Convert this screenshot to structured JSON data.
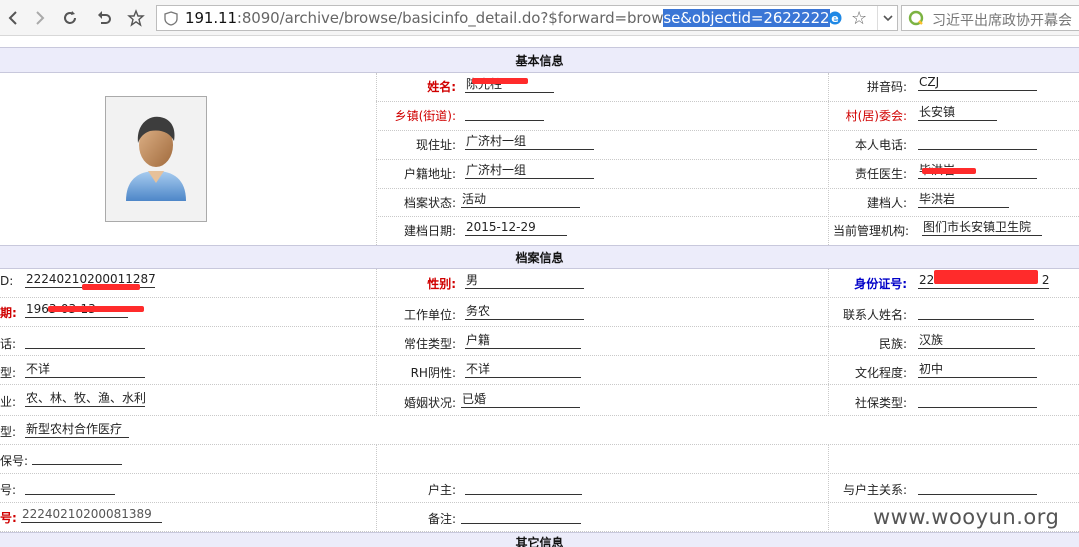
{
  "browser": {
    "url_host": "191.11",
    "url_port_path": ":8090/archive/browse/basicinfo_detail.do?$forward=brow",
    "url_selected": "se&objectid=2622222",
    "search_text": "习近平出席政协开幕会"
  },
  "sections": {
    "basic": "基本信息",
    "archive": "档案信息",
    "other": "其它信息"
  },
  "basic": {
    "name_label": "姓名:",
    "name_value": "陈光柱",
    "pinyin_label": "拼音码:",
    "pinyin_value": "CZJ",
    "township_label": "乡镇(街道):",
    "township_value": "",
    "village_label": "村(居)委会:",
    "village_value": "长安镇",
    "address_label": "现住址:",
    "address_value": "广济村一组",
    "phone_label": "本人电话:",
    "phone_value": "",
    "household_label": "户籍地址:",
    "household_value": "广济村一组",
    "doctor_label": "责任医生:",
    "doctor_value": "毕洪岩",
    "status_label": "档案状态:",
    "status_value": "活动",
    "creator_label": "建档人:",
    "creator_value": "毕洪岩",
    "date_label": "建档日期:",
    "date_value": "2015-12-29",
    "org_label": "当前管理机构:",
    "org_value": "图们市长安镇卫生院"
  },
  "archive": {
    "id_label": "D:",
    "id_value": "22240210200011287",
    "gender_label": "性别:",
    "gender_value": "男",
    "idcard_label": "身份证号:",
    "idcard_prefix": "222",
    "idcard_suffix": "2",
    "birth_label": "期:",
    "birth_value": "1963-03-13",
    "work_label": "工作单位:",
    "work_value": "务农",
    "contact_label": "联系人姓名:",
    "contact_value": "",
    "tel_label": "话:",
    "tel_value": "",
    "residence_label": "常住类型:",
    "residence_value": "户籍",
    "ethnic_label": "民族:",
    "ethnic_value": "汉族",
    "blood_label": "型:",
    "blood_value": "不详",
    "rh_label": "RH阴性:",
    "rh_value": "不详",
    "edu_label": "文化程度:",
    "edu_value": "初中",
    "job_label": "业:",
    "job_value": "农、林、牧、渔、水利",
    "marital_label": "婚姻状况:",
    "marital_value": "已婚",
    "social_label": "社保类型:",
    "social_value": "",
    "insure_label": "型:",
    "insure_value": "新型农村合作医疗",
    "insure_no_label": "保号:",
    "insure_no_value": "",
    "no2_label": "号:",
    "no2_value": "",
    "head_label": "户主:",
    "head_value": "",
    "relation_label": "与户主关系:",
    "relation_value": "",
    "no3_label": "号:",
    "no3_value": "22240210200081389",
    "remark_label": "备注:",
    "remark_value": ""
  },
  "watermark": "www.wooyun.org",
  "colors": {
    "section_bg": "#ececfa",
    "required_red": "#d00000",
    "idcard_blue": "#0000c8",
    "redaction": "#ff2b2b"
  }
}
